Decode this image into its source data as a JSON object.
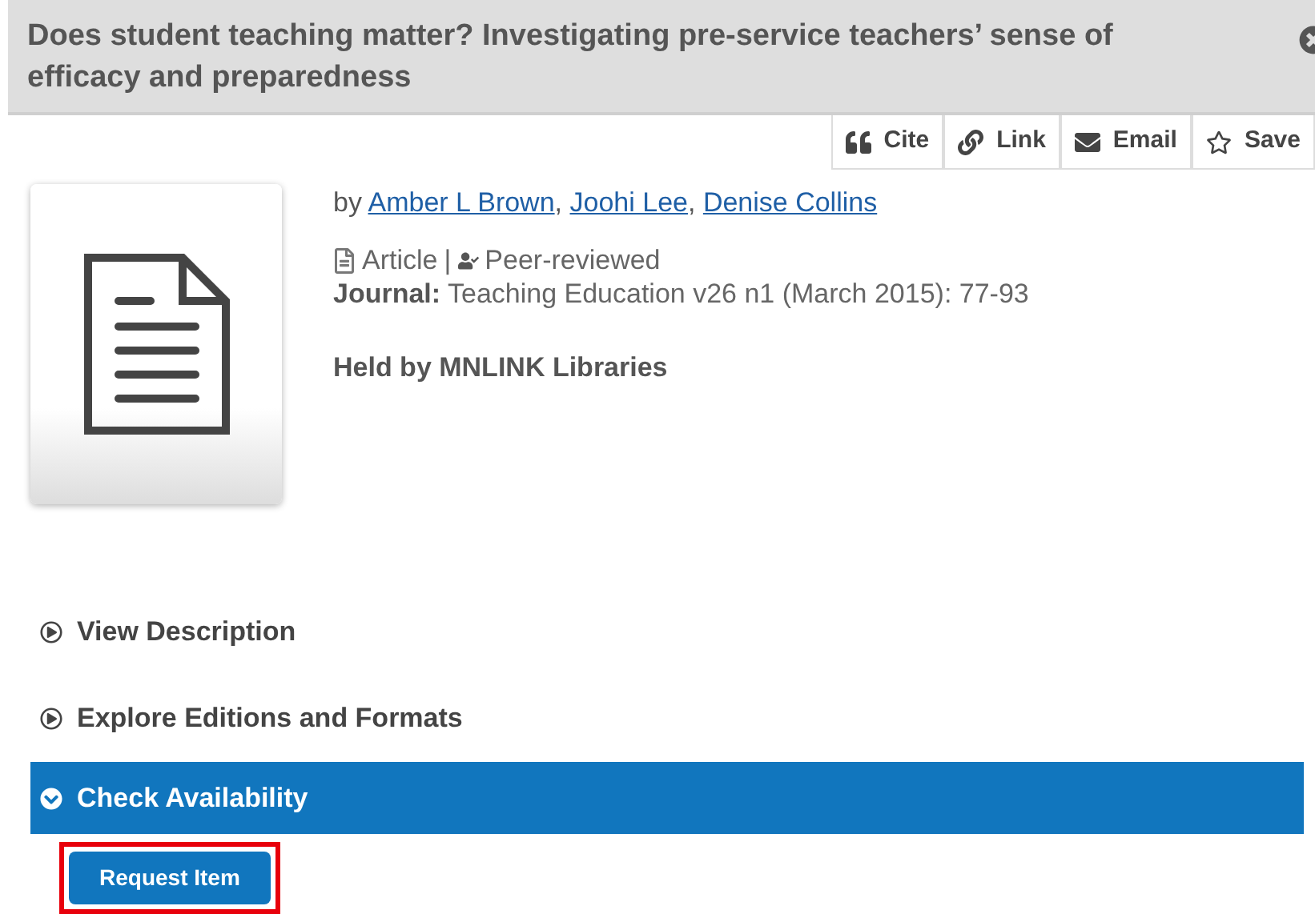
{
  "title": "Does student teaching matter? Investigating pre-service teachers’ sense of efficacy and preparedness",
  "actions": [
    {
      "kind": "cite",
      "label": "Cite"
    },
    {
      "kind": "link",
      "label": "Link"
    },
    {
      "kind": "email",
      "label": "Email"
    },
    {
      "kind": "save",
      "label": "Save"
    }
  ],
  "record": {
    "by": "by",
    "authors": [
      "Amber L Brown",
      "Joohi Lee",
      "Denise Collins"
    ],
    "author_separator": ",",
    "format": "Article",
    "separator": "|",
    "review": "Peer-reviewed",
    "journal_label": "Journal:",
    "journal": "Teaching Education v26 n1 (March 2015): 77-93",
    "held_by": "Held by MNLINK Libraries"
  },
  "sections": [
    {
      "label": "View Description",
      "expanded": false
    },
    {
      "label": "Explore Editions and Formats",
      "expanded": false
    },
    {
      "label": "Check Availability",
      "expanded": true
    }
  ],
  "request_button": {
    "label": "Request Item",
    "highlighted": true
  }
}
